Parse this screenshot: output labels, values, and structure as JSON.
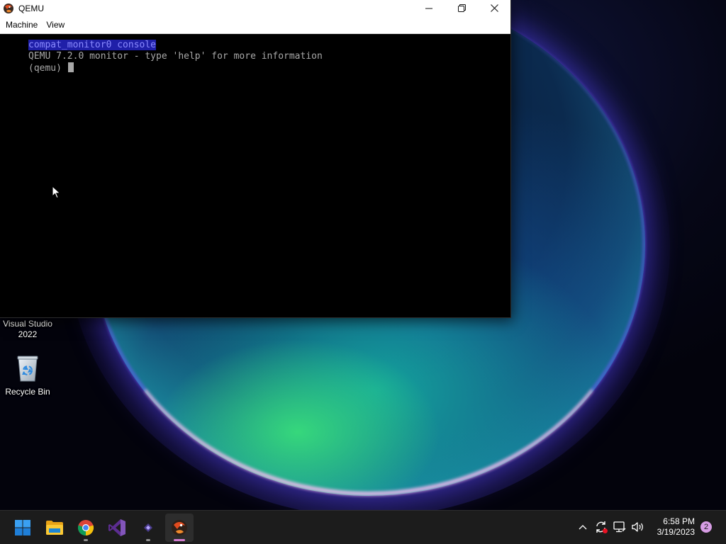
{
  "window": {
    "title": "QEMU",
    "menu": [
      "Machine",
      "View"
    ]
  },
  "console": {
    "header": "compat_monitor0 console",
    "banner": "QEMU 7.2.0 monitor - type 'help' for more information",
    "prompt": "(qemu) "
  },
  "desktop": {
    "icons": [
      {
        "label": "Visual Studio 2022",
        "icon": "visual-studio-icon"
      },
      {
        "label": "Recycle Bin",
        "icon": "recycle-bin-icon"
      }
    ]
  },
  "taskbar": {
    "apps": [
      {
        "name": "Start",
        "icon": "windows-start-icon"
      },
      {
        "name": "File Explorer",
        "icon": "folder-icon"
      },
      {
        "name": "Google Chrome",
        "icon": "chrome-icon"
      },
      {
        "name": "Visual Studio",
        "icon": "visual-studio-icon"
      },
      {
        "name": "Visual Studio Installer",
        "icon": "vs-installer-icon"
      },
      {
        "name": "QEMU",
        "icon": "qemu-icon",
        "active": true
      }
    ],
    "clock": {
      "time": "6:58 PM",
      "date": "3/19/2023"
    },
    "notification_count": "2"
  },
  "colors": {
    "console_text": "#a8a8a8",
    "console_highlight_bg": "#1f1fa8",
    "taskbar_bg": "#1c1c1c",
    "active_indicator": "#d37bd0",
    "notification_badge": "#d79de5"
  }
}
